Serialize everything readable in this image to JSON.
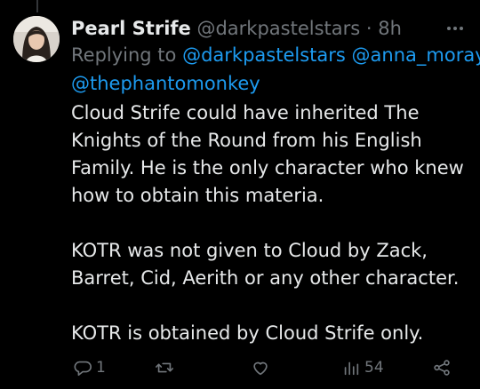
{
  "tweet": {
    "display_name": "Pearl Strife",
    "handle": "@darkpastelstars",
    "separator": "·",
    "time": "8h",
    "replying_to_label": "Replying to",
    "mentions": [
      "@darkpastelstars",
      "@anna_moray",
      "@thephantomonkey"
    ],
    "paragraphs": [
      [
        "Cloud Strife could have inherited The",
        "Knights of the Round from his English",
        "Family. He is the only character who knew",
        "how to obtain this materia."
      ],
      [
        "KOTR was not given to Cloud by Zack,",
        "Barret, Cid, Aerith or any other character."
      ],
      [
        "KOTR is obtained by Cloud Strife only."
      ]
    ]
  },
  "actions": {
    "reply_count": "1",
    "retweet_count": "",
    "like_count": "",
    "views_count": "54"
  },
  "icons": {
    "more": "more-icon",
    "reply": "reply-icon",
    "retweet": "retweet-icon",
    "like": "heart-icon",
    "views": "views-icon",
    "share": "share-icon"
  },
  "colors": {
    "background": "#000000",
    "text": "#e7e9ea",
    "muted": "#71767b",
    "link": "#1d9bf0"
  }
}
